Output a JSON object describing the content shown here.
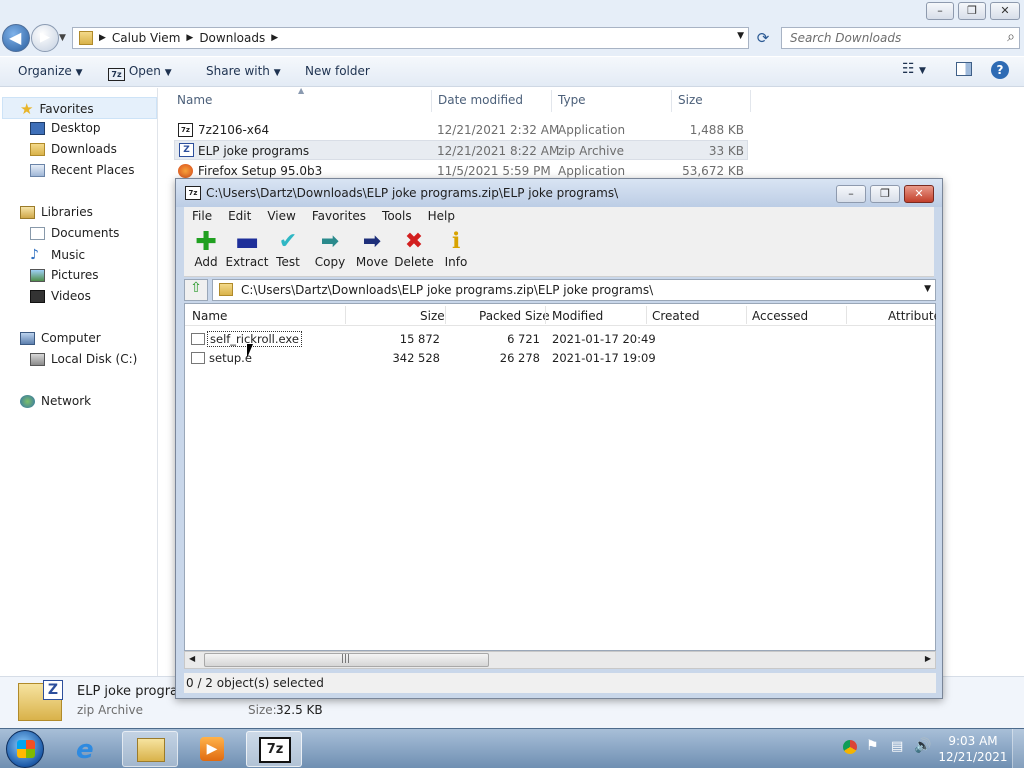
{
  "explorer": {
    "address": {
      "segments": [
        "Calub Viem",
        "Downloads"
      ]
    },
    "search_placeholder": "Search Downloads",
    "toolbar": {
      "organize": "Organize",
      "open": "Open",
      "share_with": "Share with",
      "new_folder": "New folder"
    },
    "nav": {
      "favorites": "Favorites",
      "desktop": "Desktop",
      "downloads": "Downloads",
      "recent": "Recent Places",
      "libraries": "Libraries",
      "documents": "Documents",
      "music": "Music",
      "pictures": "Pictures",
      "videos": "Videos",
      "computer": "Computer",
      "local_disk": "Local Disk (C:)",
      "network": "Network"
    },
    "columns": {
      "name": "Name",
      "date": "Date modified",
      "type": "Type",
      "size": "Size"
    },
    "files": [
      {
        "name": "7z2106-x64",
        "date": "12/21/2021 2:32 AM",
        "type": "Application",
        "size": "1,488 KB"
      },
      {
        "name": "ELP joke programs",
        "date": "12/21/2021 8:22 AM",
        "type": "zip Archive",
        "size": "33 KB"
      },
      {
        "name": "Firefox Setup 95.0b3",
        "date": "11/5/2021 5:59 PM",
        "type": "Application",
        "size": "53,672 KB"
      }
    ],
    "details": {
      "name": "ELP joke programs",
      "type": "zip Archive",
      "size_label": "Size:",
      "size_value": "32.5 KB"
    }
  },
  "sevenzip": {
    "title": "C:\\Users\\Dartz\\Downloads\\ELP joke programs.zip\\ELP joke programs\\",
    "menu": [
      "File",
      "Edit",
      "View",
      "Favorites",
      "Tools",
      "Help"
    ],
    "tools": {
      "add": "Add",
      "extract": "Extract",
      "test": "Test",
      "copy": "Copy",
      "move": "Move",
      "delete": "Delete",
      "info": "Info"
    },
    "path": "C:\\Users\\Dartz\\Downloads\\ELP joke programs.zip\\ELP joke programs\\",
    "columns": {
      "name": "Name",
      "size": "Size",
      "packed": "Packed Size",
      "modified": "Modified",
      "created": "Created",
      "accessed": "Accessed",
      "attributes": "Attributes"
    },
    "rows": [
      {
        "name": "self_rickroll.exe",
        "size": "15 872",
        "packed": "6 721",
        "modified": "2021-01-17 20:49"
      },
      {
        "name": "setup.e",
        "size": "342 528",
        "packed": "26 278",
        "modified": "2021-01-17 19:09"
      }
    ],
    "status": "0 / 2 object(s) selected"
  },
  "taskbar": {
    "time": "9:03 AM",
    "date": "12/21/2021"
  },
  "colors": {
    "selection": "#e5f0fb",
    "sevenzip_frame": "#c9d7ea",
    "taskbar": "#7f9dc0"
  }
}
